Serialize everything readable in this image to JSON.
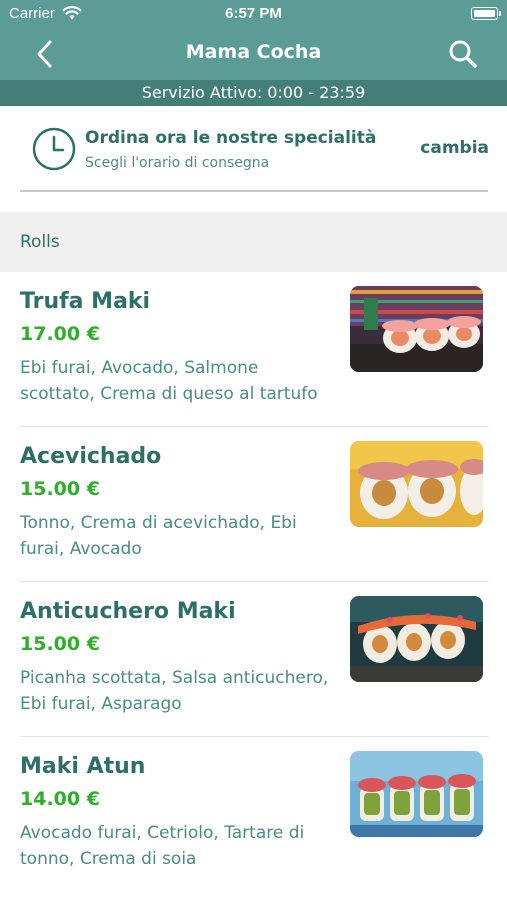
{
  "status_bar": {
    "carrier": "Carrier",
    "time": "6:57 PM"
  },
  "nav": {
    "title": "Mama Cocha",
    "back_icon": "chevron-left-icon",
    "search_icon": "search-icon"
  },
  "service": {
    "text": "Servizio Attivo: 0:00 - 23:59"
  },
  "order": {
    "icon": "clock-icon",
    "title": "Ordina ora le nostre specialità",
    "subtitle": "Scegli l'orario di consegna",
    "change_label": "cambia"
  },
  "section": {
    "label": "Rolls"
  },
  "items": [
    {
      "name": "Trufa Maki",
      "price": "17.00 €",
      "description": "Ebi furai, Avocado, Salmone scottato, Crema di queso al tartufo"
    },
    {
      "name": "Acevichado",
      "price": "15.00 €",
      "description": "Tonno, Crema di acevichado, Ebi furai, Avocado"
    },
    {
      "name": "Anticuchero Maki",
      "price": "15.00 €",
      "description": "Picanha scottata, Salsa anticuchero, Ebi furai, Asparago"
    },
    {
      "name": "Maki Atun",
      "price": "14.00 €",
      "description": "Avocado furai, Cetriolo, Tartare di tonno, Crema di soia"
    }
  ],
  "colors": {
    "header": "#5b9c97",
    "service_bar": "#437e79",
    "text_teal": "#2f6f6a",
    "price_green": "#2eae2a"
  }
}
